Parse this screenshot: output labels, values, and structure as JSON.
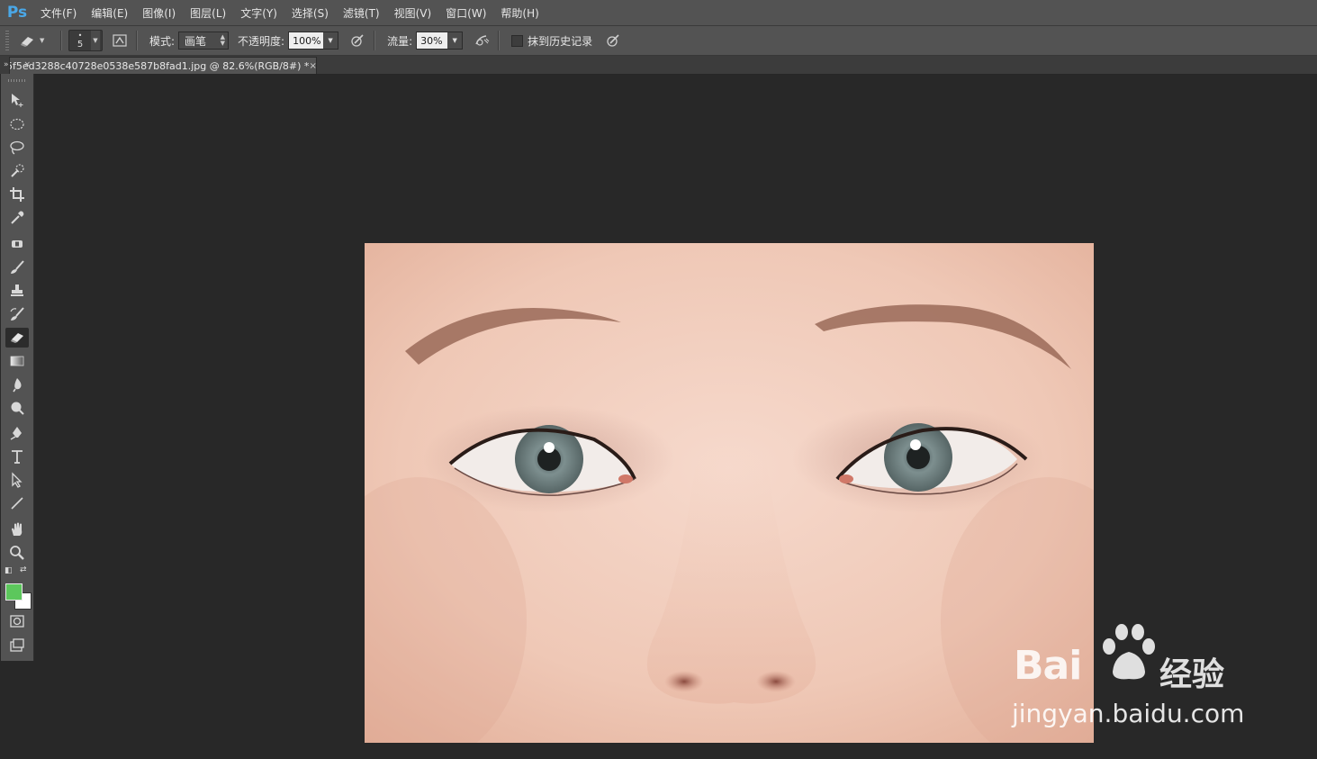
{
  "app": {
    "logo": "Ps"
  },
  "menu": [
    "文件(F)",
    "编辑(E)",
    "图像(I)",
    "图层(L)",
    "文字(Y)",
    "选择(S)",
    "滤镜(T)",
    "视图(V)",
    "窗口(W)",
    "帮助(H)"
  ],
  "options": {
    "brush_size": "5",
    "mode_label": "模式:",
    "mode_value": "画笔",
    "opacity_label": "不透明度:",
    "opacity_value": "100%",
    "flow_label": "流量:",
    "flow_value": "30%",
    "erase_history_label": "抹到历史记录",
    "erase_history_checked": false
  },
  "document": {
    "tab_title": "5f5ed3288c40728e0538e587b8fad1.jpg @ 82.6%(RGB/8#) *",
    "close_glyph": "×"
  },
  "panel_grip": {
    "expand": "»",
    "close": "×"
  },
  "colors": {
    "foreground": "#5cc75c",
    "background": "#ffffff",
    "ps_blue": "#4aa8e8"
  },
  "tools": [
    "move-tool",
    "marquee-tool",
    "lasso-tool",
    "quick-select-tool",
    "crop-tool",
    "eyedropper-tool",
    "healing-brush-tool",
    "brush-tool",
    "clone-stamp-tool",
    "history-brush-tool",
    "eraser-tool",
    "gradient-tool",
    "blur-tool",
    "dodge-tool",
    "pen-tool",
    "type-tool",
    "path-select-tool",
    "line-tool",
    "hand-tool",
    "zoom-tool"
  ],
  "active_tool": "eraser-tool",
  "watermark": {
    "brand": "Bai",
    "brand_cn": "经验",
    "url": "jingyan.baidu.com"
  }
}
